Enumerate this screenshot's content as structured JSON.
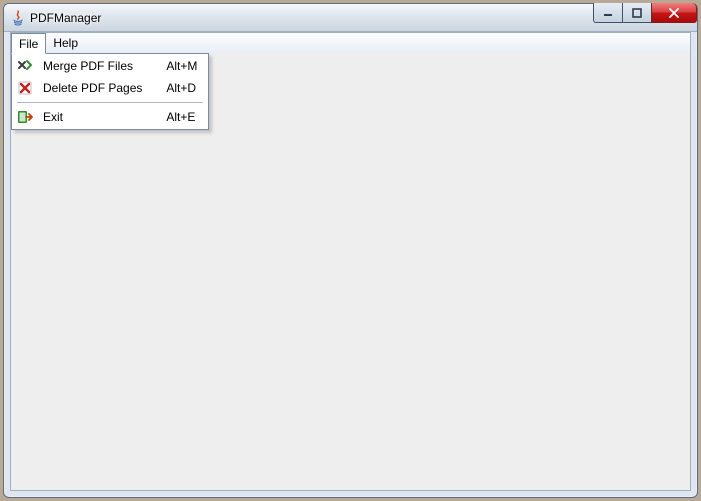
{
  "window": {
    "title": "PDFManager"
  },
  "menubar": {
    "file": {
      "label": "File"
    },
    "help": {
      "label": "Help"
    }
  },
  "file_menu": {
    "merge": {
      "label": "Merge PDF Files",
      "shortcut": "Alt+M"
    },
    "delete": {
      "label": "Delete PDF Pages",
      "shortcut": "Alt+D"
    },
    "exit": {
      "label": "Exit",
      "shortcut": "Alt+E"
    }
  }
}
